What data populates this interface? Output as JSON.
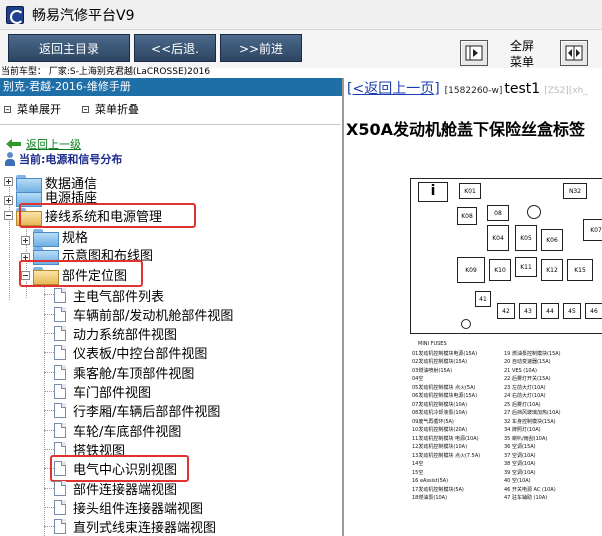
{
  "app": {
    "title": "畅易汽修平台V9",
    "icon": "app-logo-icon"
  },
  "toolbar": {
    "home_label": "返回主目录",
    "back_label": "<<后退.",
    "forward_label": ">>前进",
    "fullscreen_label_line1": "全屏",
    "fullscreen_label_line2": "菜单"
  },
  "vehicle": {
    "line": "当前车型： 厂家:S-上海别克君越(LaCROSSE)2016"
  },
  "left": {
    "header": "别克-君越-2016-维修手册",
    "expand_all": "菜单展开",
    "collapse_all": "菜单折叠",
    "back_up": "返回上一级",
    "current": "当前:电源和信号分布",
    "tree": [
      {
        "label": "数据通信"
      },
      {
        "label": "电源插座"
      },
      {
        "label": "接线系统和电源管理"
      },
      {
        "label": "规格"
      },
      {
        "label": "示意图和布线图"
      },
      {
        "label": "部件定位图"
      },
      {
        "label": "主电气部件列表"
      },
      {
        "label": "车辆前部/发动机舱部件视图"
      },
      {
        "label": "动力系统部件视图"
      },
      {
        "label": "仪表板/中控台部件视图"
      },
      {
        "label": "乘客舱/车顶部件视图"
      },
      {
        "label": "车门部件视图"
      },
      {
        "label": "行李厢/车辆后部部件视图"
      },
      {
        "label": "车轮/车底部件视图"
      },
      {
        "label": "搭铁视图"
      },
      {
        "label": "电气中心识别视图"
      },
      {
        "label": "部件连接器端视图"
      },
      {
        "label": "接头组件连接器端视图"
      },
      {
        "label": "直列式线束连接器端视图"
      }
    ]
  },
  "right": {
    "back_prefix": "[",
    "back_text": "<返回上一页",
    "back_suffix": "]",
    "doc_id": "[1582260-w]",
    "doc_name": "test1",
    "doc_tag": "[ZS2][xh_",
    "title": "X50A发动机舱盖下保险丝盒标签",
    "fuse_labels": [
      "K01",
      "N32",
      "K08",
      "08",
      "K07",
      "K04",
      "K05",
      "K06",
      "K09",
      "K10",
      "K11",
      "K12",
      "K15",
      "41",
      "42",
      "43",
      "44",
      "45",
      "46"
    ],
    "legend_title": "MINI FUSES",
    "legend_rows": [
      [
        "01发动机控制模块电源(15A)",
        "19 燃油泵控制模块(15A)"
      ],
      [
        "02发动机控制模块(15A)",
        "20 自动变速器(15A)"
      ],
      [
        "03燃油喷射(15A)",
        "21 VES (10A)"
      ],
      [
        "04空",
        "22 后雾灯开关(15A)"
      ],
      [
        "05发动机控制模块 点火(5A)",
        "23 左前大灯(10A)"
      ],
      [
        "06发动机控制模块电源(15A)",
        "24 右前大灯(10A)"
      ],
      [
        "07发动机控制模块(10A)",
        "25 后雾灯(10A)"
      ],
      [
        "08发动机冷却液泵(10A)",
        "27 后挡风玻璃加热(10A)"
      ],
      [
        "09废气再循环(5A)",
        "32 车身控制模块(15A)"
      ],
      [
        "10发动机控制模块(20A)",
        "34 牌照灯(10A)"
      ],
      [
        "11发动机控制模块 电源(10A)",
        "35 喇叭/雨刮(10A)"
      ],
      [
        "12发动机控制模块(10A)",
        "36 空调(15A)"
      ],
      [
        "13发动机控制模块 点火(7.5A)",
        "37 空调(10A)"
      ],
      [
        "14空",
        "38 空调(10A)"
      ],
      [
        "15空",
        "39 空调(10A)"
      ],
      [
        "16 eAssist(5A)",
        "40 空(10A)"
      ],
      [
        "17发动机控制模块(5A)",
        "46 开关电源 AC (10A)"
      ],
      [
        "18燃油泵(10A)",
        "47 驻车辅助 (10A)"
      ]
    ]
  }
}
